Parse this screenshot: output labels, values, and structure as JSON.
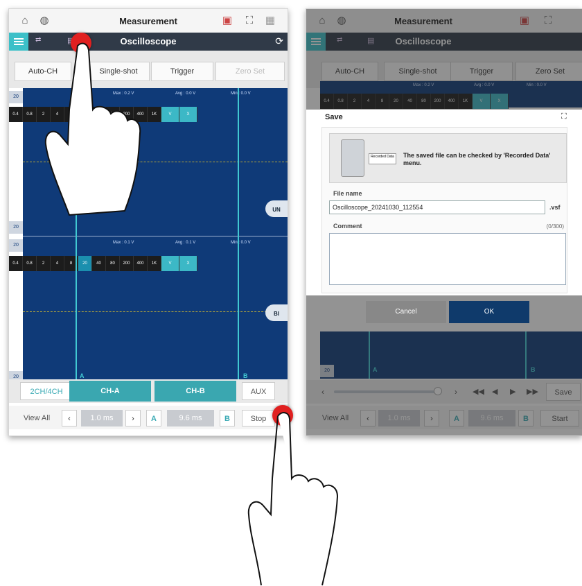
{
  "left": {
    "top_title": "Measurement",
    "sub_title": "Oscilloscope",
    "tabs": [
      "Auto-CH",
      "Single-shot",
      "Trigger",
      "Zero Set"
    ],
    "channel1": {
      "label": "20",
      "max": "Max : 0.2 V",
      "avg": "Avg : 0.0 V",
      "min": "Min : 0.0 V"
    },
    "channel2": {
      "label": "20",
      "max": "Max : 0.1 V",
      "avg": "Avg : 0.1 V",
      "min": "Min : 0.0 V"
    },
    "scale_values": [
      "0.4",
      "0.8",
      "2",
      "4",
      "8",
      "20",
      "40",
      "80",
      "200",
      "400",
      "1K",
      "V",
      "X"
    ],
    "side_up": "UN",
    "side_down": "BI",
    "cursor_a": "A",
    "cursor_b": "B",
    "axis_label_low": "20",
    "channel_buttons": {
      "ch_count": "2CH/4CH",
      "ch_a": "CH-A",
      "ch_b": "CH-B",
      "aux": "AUX"
    },
    "bottom": {
      "view_all": "View All",
      "time1": "1.0 ms",
      "a": "A",
      "time2": "9.6 ms",
      "b": "B",
      "stop": "Stop"
    }
  },
  "right": {
    "top_title": "Measurement",
    "sub_title": "Oscilloscope",
    "tabs": [
      "Auto-CH",
      "Single-shot",
      "Trigger",
      "Zero Set"
    ],
    "channel": {
      "max": "Max : 0.2 V",
      "avg": "Avg : 0.0 V",
      "min": "Min : 0.0 V"
    },
    "scale_values": [
      "0.4",
      "0.8",
      "2",
      "4",
      "8",
      "20",
      "40",
      "80",
      "200",
      "400",
      "1K",
      "V",
      "X"
    ],
    "save_dialog": {
      "title": "Save",
      "info": "The saved file can be checked by 'Recorded Data' menu.",
      "recorded_label": "Recorded Data",
      "file_name_label": "File name",
      "file_name_value": "Oscilloscope_20241030_112554",
      "extension": ".vsf",
      "comment_label": "Comment",
      "comment_count": "(0/300)",
      "comment_value": "",
      "cancel": "Cancel",
      "ok": "OK"
    },
    "cursor_a": "A",
    "cursor_b": "B",
    "axis_label_low": "20",
    "playback": {
      "save": "Save"
    },
    "bottom": {
      "view_all": "View All",
      "time1": "1.0 ms",
      "a": "A",
      "time2": "9.6 ms",
      "b": "B",
      "start": "Start"
    }
  },
  "colors": {
    "accent": "#3cc0c8",
    "scope_bg": "#0f3a78",
    "dark_bar": "#303a48",
    "ok_button": "#0f3a6b",
    "cancel_button": "#888888",
    "touch_dot": "#e02020"
  }
}
